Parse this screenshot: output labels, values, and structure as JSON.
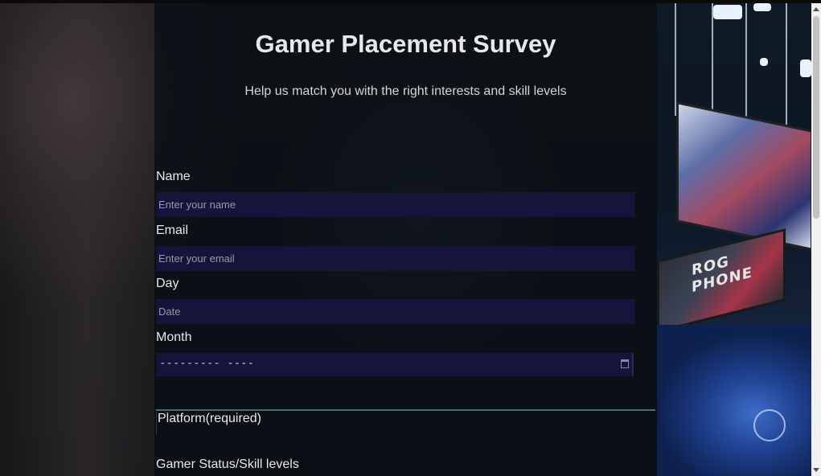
{
  "page": {
    "title": "Gamer Placement Survey",
    "description": "Help us match you with the right interests and skill levels"
  },
  "form": {
    "name": {
      "label": "Name",
      "placeholder": "Enter your name"
    },
    "email": {
      "label": "Email",
      "placeholder": "Enter your email"
    },
    "day": {
      "label": "Day",
      "placeholder": "Date"
    },
    "month": {
      "label": "Month",
      "value": "---------  ----"
    },
    "platform_legend": "Platform(required)",
    "skill_label": "Gamer Status/Skill levels"
  },
  "background": {
    "stage_screen_text": "ROG PHONE"
  },
  "colors": {
    "panel_bg": "#080e14",
    "input_bg": "#15143a",
    "text": "#e8e8e8",
    "divider": "#4b6b76"
  },
  "icons": [
    "calendar-icon",
    "scroll-up-arrow-icon",
    "scroll-down-arrow-icon"
  ]
}
